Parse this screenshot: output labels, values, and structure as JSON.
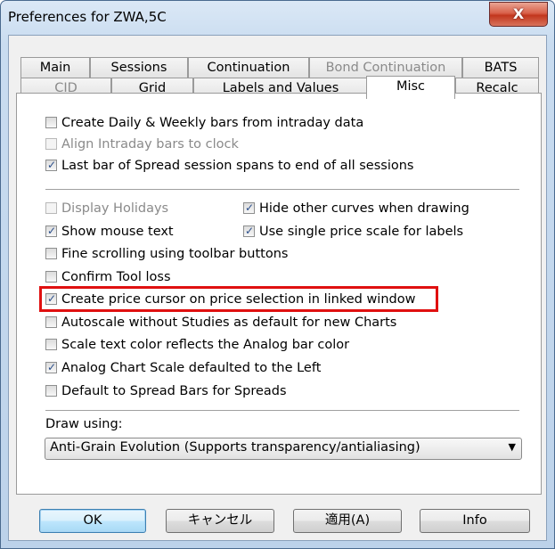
{
  "window": {
    "title": "Preferences for ZWA,5C",
    "close_glyph": "X"
  },
  "tabs_row1": [
    {
      "label": "Main",
      "disabled": false
    },
    {
      "label": "Sessions",
      "disabled": false
    },
    {
      "label": "Continuation",
      "disabled": false
    },
    {
      "label": "Bond Continuation",
      "disabled": true
    },
    {
      "label": "BATS",
      "disabled": false
    }
  ],
  "tabs_row2": [
    {
      "label": "CID",
      "disabled": true
    },
    {
      "label": "Grid",
      "disabled": false
    },
    {
      "label": "Labels and Values",
      "disabled": false
    },
    {
      "label": "Misc",
      "disabled": false,
      "active": true
    },
    {
      "label": "Recalc",
      "disabled": false
    }
  ],
  "group1": [
    {
      "label": "Create Daily & Weekly bars from intraday data",
      "checked": false,
      "disabled": false
    },
    {
      "label": "Align Intraday bars to clock",
      "checked": false,
      "disabled": true
    },
    {
      "label": "Last bar of Spread session spans to end of all sessions",
      "checked": true,
      "disabled": false
    }
  ],
  "group2": {
    "display_holidays": {
      "label": "Display Holidays",
      "checked": false,
      "disabled": true
    },
    "hide_other_curves": {
      "label": "Hide other curves when drawing",
      "checked": true,
      "disabled": false
    },
    "show_mouse_text": {
      "label": "Show mouse text",
      "checked": true,
      "disabled": false
    },
    "single_price_scale": {
      "label": "Use single price scale for labels",
      "checked": true,
      "disabled": false
    },
    "fine_scrolling": {
      "label": "Fine scrolling using toolbar buttons",
      "checked": false,
      "disabled": false
    },
    "confirm_tool_loss": {
      "label": "Confirm Tool loss",
      "checked": false,
      "disabled": false
    },
    "create_price_cursor": {
      "label": "Create price cursor on price selection in linked window",
      "checked": true,
      "disabled": false,
      "highlighted": true
    },
    "autoscale": {
      "label": "Autoscale without Studies as default for new Charts",
      "checked": false,
      "disabled": false
    },
    "scale_text_color": {
      "label": "Scale text color reflects the Analog bar color",
      "checked": false,
      "disabled": false
    },
    "analog_chart_scale": {
      "label": "Analog Chart Scale defaulted to the Left",
      "checked": true,
      "disabled": false
    },
    "default_spread_bars": {
      "label": "Default to Spread Bars for Spreads",
      "checked": false,
      "disabled": false
    }
  },
  "draw_using": {
    "label": "Draw using:",
    "value": "Anti-Grain Evolution (Supports transparency/antialiasing)"
  },
  "buttons": {
    "ok": "OK",
    "cancel": "キャンセル",
    "apply": "適用(A)",
    "info": "Info"
  },
  "colors": {
    "highlight": "#e01010",
    "close_button": "#c2361d"
  }
}
